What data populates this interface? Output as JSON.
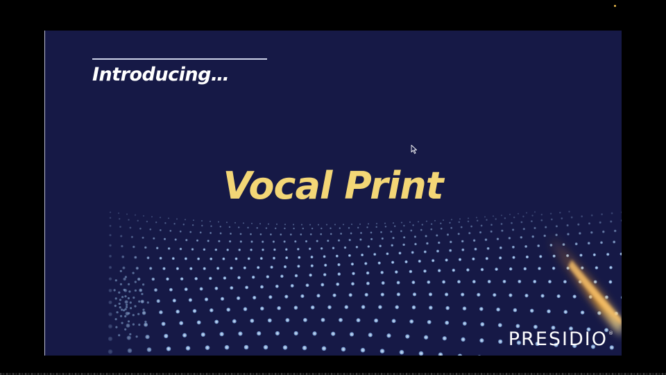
{
  "slide": {
    "intro_text": "Introducing…",
    "title": "Vocal Print",
    "logo_text": "PRESIDIO",
    "logo_mark": "®"
  },
  "icons": {
    "cursor": "mouse-pointer-icon"
  },
  "colors": {
    "background": "#000000",
    "slide_background": "#161946",
    "title": "#f3d676",
    "intro": "#ffffff",
    "dots": "#8fb2dd",
    "flare": "#f59a2a"
  }
}
